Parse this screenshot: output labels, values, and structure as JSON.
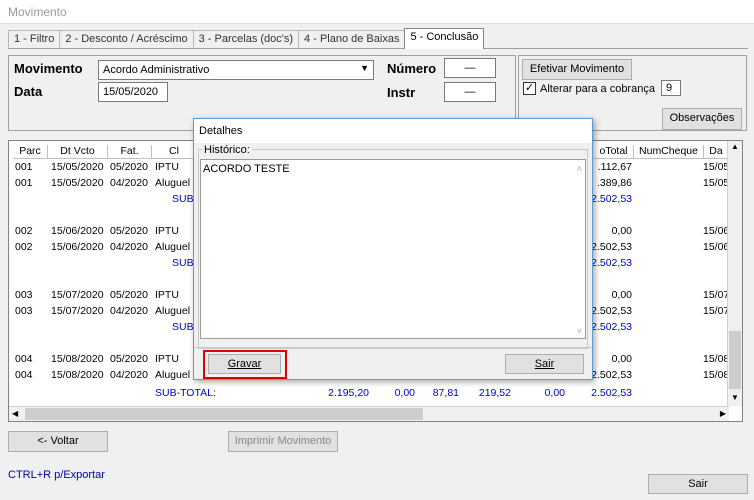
{
  "window": {
    "title": "Movimento"
  },
  "tabs": [
    {
      "label": "1 - Filtro"
    },
    {
      "label": "2 - Desconto / Acréscimo"
    },
    {
      "label": "3 - Parcelas (doc's)"
    },
    {
      "label": "4 - Plano de Baixas"
    },
    {
      "label": "5 - Conclusão"
    }
  ],
  "form": {
    "movimento_label": "Movimento",
    "movimento_value": "Acordo Administrativo",
    "data_label": "Data",
    "data_value": "15/05/2020",
    "numero_label": "Número",
    "numero_value": "—",
    "instr_label": "Instr",
    "instr_value": "—"
  },
  "right_panel": {
    "efetivar_label": "Efetivar Movimento",
    "alterar_label": "Alterar para a cobrança",
    "alterar_checked": true,
    "alterar_value": "9",
    "observacoes_label": "Observações"
  },
  "grid": {
    "headers": [
      "Parc",
      "Dt Vcto",
      "Fat.",
      "Cl",
      "oTotal",
      "NumCheque",
      "Da"
    ],
    "rows": [
      {
        "parc": "001",
        "dt": "15/05/2020",
        "fat": "05/2020",
        "cl": "IPTU",
        "total": ".112,67",
        "da": "15/05"
      },
      {
        "parc": "001",
        "dt": "15/05/2020",
        "fat": "04/2020",
        "cl": "Aluguel",
        "total": ".389,86",
        "da": "15/05"
      },
      {
        "sub": "SUB",
        "total": "2.502,53"
      },
      {
        "parc": "002",
        "dt": "15/06/2020",
        "fat": "05/2020",
        "cl": "IPTU",
        "total": "0,00",
        "da": "15/06"
      },
      {
        "parc": "002",
        "dt": "15/06/2020",
        "fat": "04/2020",
        "cl": "Aluguel",
        "total": "2.502,53",
        "da": "15/06"
      },
      {
        "sub": "SUB",
        "total": "2.502,53"
      },
      {
        "parc": "003",
        "dt": "15/07/2020",
        "fat": "05/2020",
        "cl": "IPTU",
        "total": "0,00",
        "da": "15/07"
      },
      {
        "parc": "003",
        "dt": "15/07/2020",
        "fat": "04/2020",
        "cl": "Aluguel",
        "total": "2.502,53",
        "da": "15/07"
      },
      {
        "sub": "SUB",
        "total": "2.502,53"
      },
      {
        "parc": "004",
        "dt": "15/08/2020",
        "fat": "05/2020",
        "cl": "IPTU",
        "total": "0,00",
        "da": "15/08"
      },
      {
        "parc": "004",
        "dt": "15/08/2020",
        "fat": "04/2020",
        "cl": "Aluguel",
        "total": "2.502,53",
        "da": "15/08"
      }
    ],
    "subtotal": {
      "label": "SUB-TOTAL:",
      "values": [
        "2.195,20",
        "0,00",
        "87,81",
        "219,52",
        "0,00",
        "2.502,53"
      ]
    }
  },
  "bottom": {
    "voltar_label": "<- Voltar",
    "imprimir_label": "Imprimir Movimento",
    "export_hint": "CTRL+R p/Exportar",
    "sair_label": "Sair"
  },
  "dialog": {
    "title": "Detalhes",
    "historico_label": "Histórico:",
    "historico_text": "ACORDO TESTE",
    "gravar_label": "Gravar",
    "sair_label": "Sair"
  },
  "colors": {
    "highlight_red": "#e00000",
    "subtotal_blue": "#0000cc",
    "dialog_border": "#5f9ad6"
  }
}
